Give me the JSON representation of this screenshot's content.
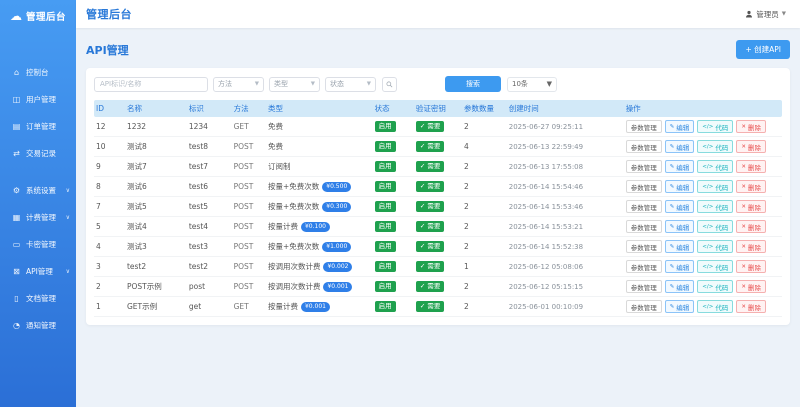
{
  "app": {
    "logo_text": "管理后台",
    "header_title": "管理后台",
    "user_name": "管理员",
    "accent_color": "#2878d8",
    "sidebar_gradient": [
      "#479cf3",
      "#2b6fd6"
    ]
  },
  "sidebar": {
    "items": [
      {
        "icon": "dashboard-icon",
        "glyph": "⌂",
        "label": "控制台",
        "chevron": ""
      },
      {
        "icon": "users-icon",
        "glyph": "◫",
        "label": "用户管理",
        "chevron": ""
      },
      {
        "icon": "orders-icon",
        "glyph": "▤",
        "label": "订单管理",
        "chevron": ""
      },
      {
        "icon": "transactions-icon",
        "glyph": "⇄",
        "label": "交易记录",
        "chevron": ""
      },
      {
        "icon": "settings-icon",
        "glyph": "⚙",
        "label": "系统设置",
        "chevron": "∨",
        "gap": true
      },
      {
        "icon": "billing-icon",
        "glyph": "▦",
        "label": "计费管理",
        "chevron": "∨"
      },
      {
        "icon": "card-key-icon",
        "glyph": "▭",
        "label": "卡密管理",
        "chevron": ""
      },
      {
        "icon": "api-icon",
        "glyph": "⊠",
        "label": "API管理",
        "chevron": "∨"
      },
      {
        "icon": "document-icon",
        "glyph": "▯",
        "label": "文档管理",
        "chevron": ""
      },
      {
        "icon": "notification-icon",
        "glyph": "◔",
        "label": "通知管理",
        "chevron": ""
      }
    ]
  },
  "page": {
    "title": "API管理",
    "create_button": "+ 创建API"
  },
  "filters": {
    "search_placeholder": "API标识/名称",
    "selects": [
      "方法",
      "类型",
      "状态"
    ],
    "search_button": "搜索",
    "page_size": "10条"
  },
  "table": {
    "columns": [
      "ID",
      "名称",
      "标识",
      "方法",
      "类型",
      "状态",
      "验证密钥",
      "参数数量",
      "创建时间",
      "操作"
    ],
    "rows": [
      {
        "id": "12",
        "name": "1232",
        "code": "1234",
        "method": "GET",
        "type": "免费",
        "price": "",
        "status": "启用",
        "key": "✓ 需要",
        "params": "2",
        "created": "2025-06-27 09:25:11"
      },
      {
        "id": "10",
        "name": "测试8",
        "code": "test8",
        "method": "POST",
        "type": "免费",
        "price": "",
        "status": "启用",
        "key": "✓ 需要",
        "params": "4",
        "created": "2025-06-13 22:59:49"
      },
      {
        "id": "9",
        "name": "测试7",
        "code": "test7",
        "method": "POST",
        "type": "订阅制",
        "price": "",
        "status": "启用",
        "key": "✓ 需要",
        "params": "2",
        "created": "2025-06-13 17:55:08"
      },
      {
        "id": "8",
        "name": "测试6",
        "code": "test6",
        "method": "POST",
        "type": "按量+免费次数",
        "price": "¥0.500",
        "status": "启用",
        "key": "✓ 需要",
        "params": "2",
        "created": "2025-06-14 15:54:46"
      },
      {
        "id": "7",
        "name": "测试5",
        "code": "test5",
        "method": "POST",
        "type": "按量+免费次数",
        "price": "¥0.300",
        "status": "启用",
        "key": "✓ 需要",
        "params": "2",
        "created": "2025-06-14 15:53:46"
      },
      {
        "id": "5",
        "name": "测试4",
        "code": "test4",
        "method": "POST",
        "type": "按量计费",
        "price": "¥0.100",
        "status": "启用",
        "key": "✓ 需要",
        "params": "2",
        "created": "2025-06-14 15:53:21"
      },
      {
        "id": "4",
        "name": "测试3",
        "code": "test3",
        "method": "POST",
        "type": "按量+免费次数",
        "price": "¥1.000",
        "status": "启用",
        "key": "✓ 需要",
        "params": "2",
        "created": "2025-06-14 15:52:38"
      },
      {
        "id": "3",
        "name": "test2",
        "code": "test2",
        "method": "POST",
        "type": "按调用次数计费",
        "price": "¥0.002",
        "status": "启用",
        "key": "✓ 需要",
        "params": "1",
        "created": "2025-06-12 05:08:06"
      },
      {
        "id": "2",
        "name": "POST示例",
        "code": "post",
        "method": "POST",
        "type": "按调用次数计费",
        "price": "¥0.001",
        "status": "启用",
        "key": "✓ 需要",
        "params": "2",
        "created": "2025-06-12 05:15:15"
      },
      {
        "id": "1",
        "name": "GET示例",
        "code": "get",
        "method": "GET",
        "type": "按量计费",
        "price": "¥0.001",
        "status": "启用",
        "key": "✓ 需要",
        "params": "2",
        "created": "2025-06-01 00:10:09"
      }
    ]
  },
  "actions": [
    {
      "label": "参数管理",
      "icon": ""
    },
    {
      "label": "编辑",
      "icon": "✎"
    },
    {
      "label": "代码",
      "icon": "</>"
    },
    {
      "label": "删除",
      "icon": "✕"
    }
  ]
}
